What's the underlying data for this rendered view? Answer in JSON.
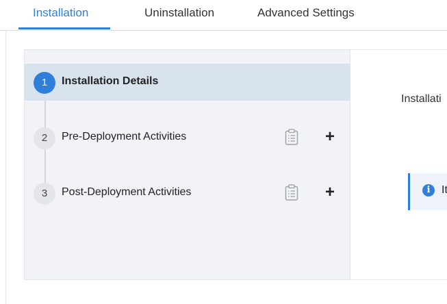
{
  "tabs": [
    {
      "label": "Installation",
      "active": true
    },
    {
      "label": "Uninstallation",
      "active": false
    },
    {
      "label": "Advanced Settings",
      "active": false
    }
  ],
  "steps": [
    {
      "number": "1",
      "label": "Installation Details",
      "active": true
    },
    {
      "number": "2",
      "label": "Pre-Deployment Activities",
      "active": false,
      "icons": [
        "clipboard-icon",
        "plus-icon"
      ]
    },
    {
      "number": "3",
      "label": "Post-Deployment Activities",
      "active": false,
      "icons": [
        "clipboard-icon",
        "plus-icon"
      ]
    }
  ],
  "right_pane": {
    "heading": "Installati",
    "info": {
      "icon": "info-icon",
      "text": "It"
    }
  },
  "plus_glyph": "+",
  "colors": {
    "accent": "#2f7fd8",
    "active_step_bg": "#d9e3ee",
    "panel_bg": "#f1f3f6"
  }
}
